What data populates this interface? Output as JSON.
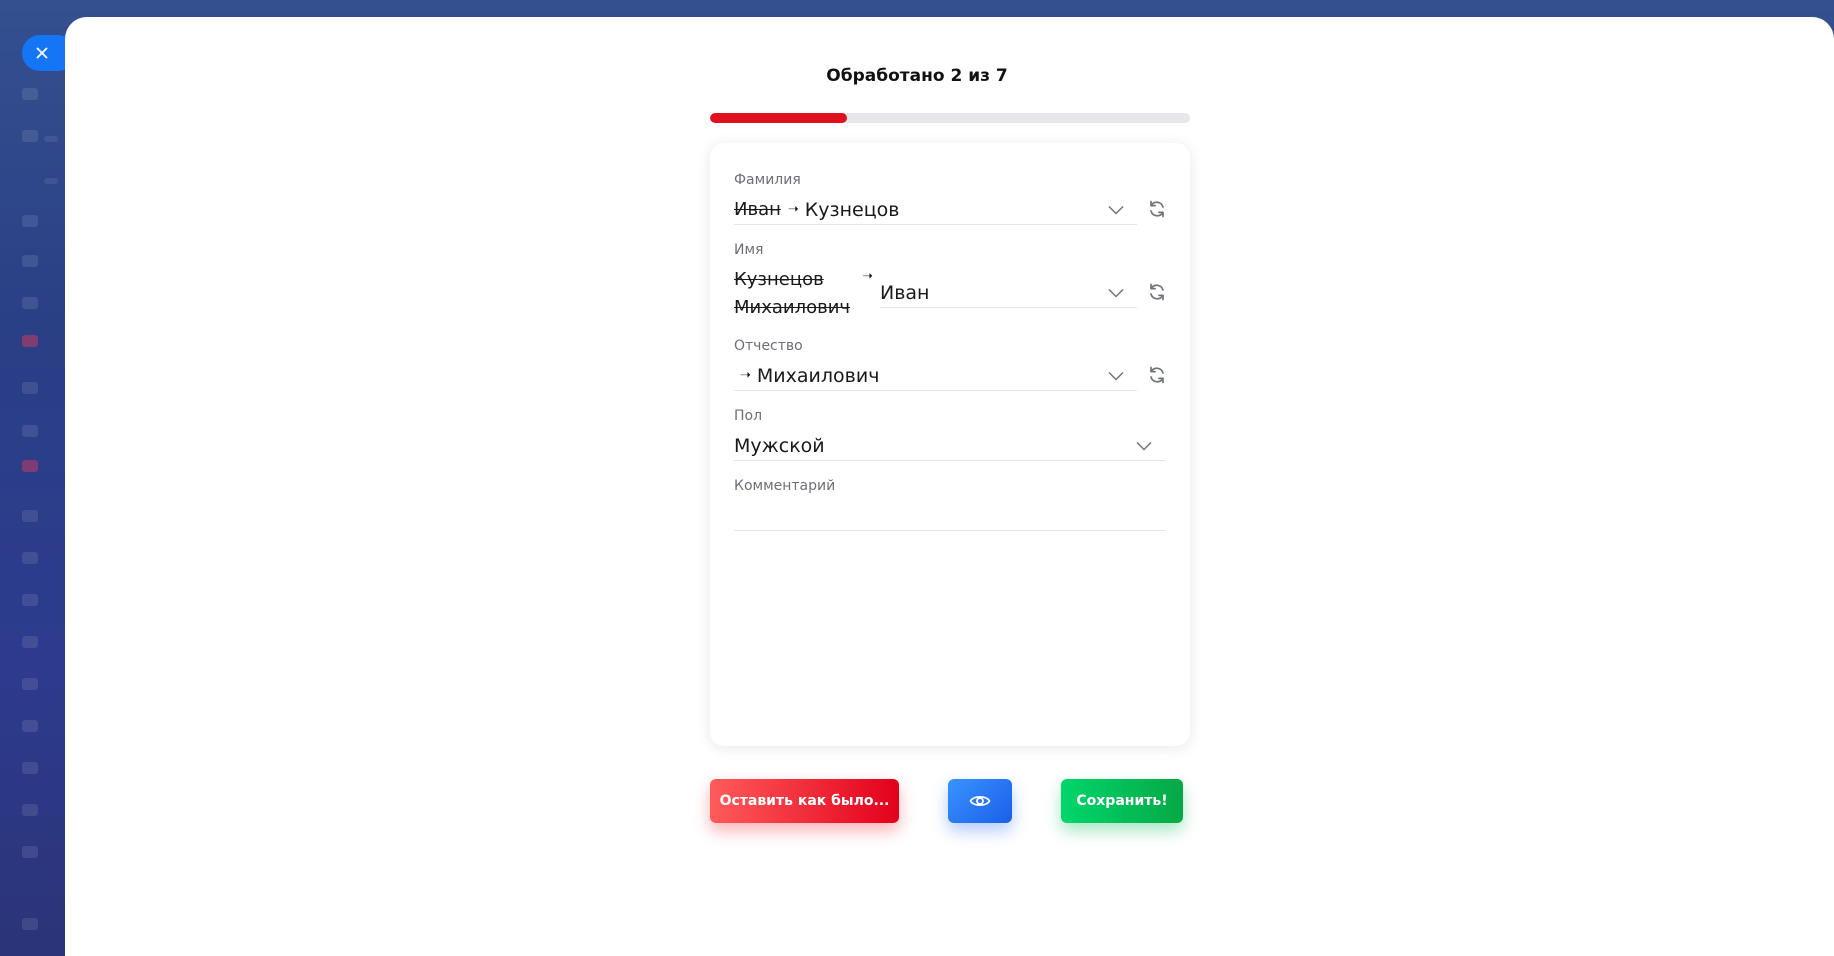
{
  "progress": {
    "title": "Обработано 2 из 7",
    "processed": 2,
    "total": 7,
    "fraction": 0.2857,
    "color": "#e0101e"
  },
  "close_icon": "close-icon",
  "fields": {
    "surname": {
      "label": "Фамилия",
      "old_value": "Иван",
      "arrow": "➝",
      "new_value": "Кузнецов"
    },
    "name": {
      "label": "Имя",
      "old_value_line1": "Кузнецов",
      "old_value_line2": "Михаилович",
      "arrow": "➝",
      "new_value": "Иван"
    },
    "patronymic": {
      "label": "Отчество",
      "arrow": "➝",
      "new_value": "Михаилович"
    },
    "gender": {
      "label": "Пол",
      "value": "Мужской"
    },
    "comment": {
      "label": "Комментарий",
      "value": ""
    }
  },
  "buttons": {
    "reset_label": "Оставить как было...",
    "preview_icon": "eye-icon",
    "save_label": "Сохранить!"
  },
  "colors": {
    "reset": "#e3001b",
    "preview": "#1a5fe8",
    "save": "#06a845",
    "close": "#1576f5"
  }
}
